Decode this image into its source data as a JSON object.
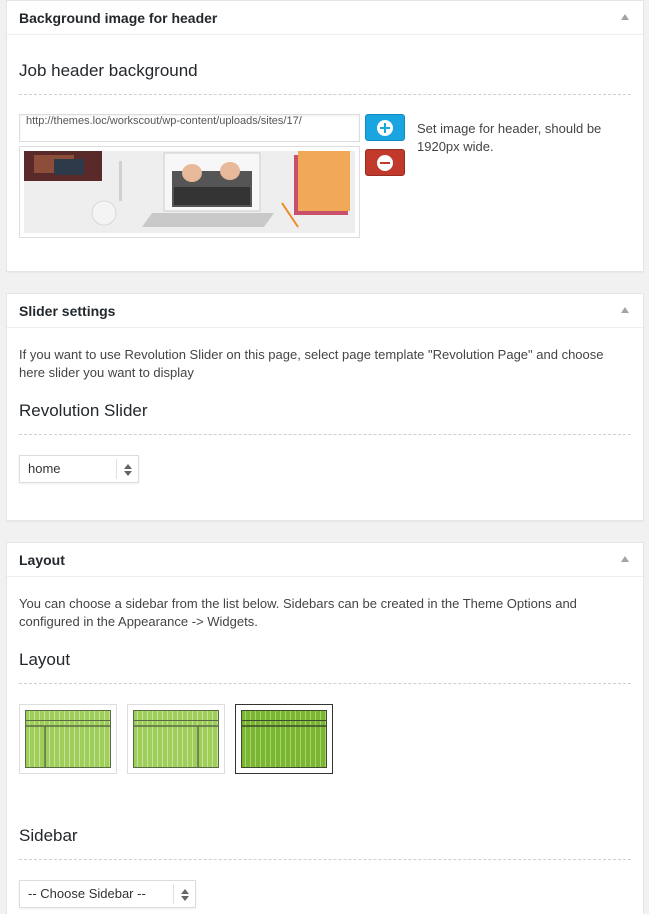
{
  "header_box": {
    "title": "Background image for header",
    "field_label": "Job header background",
    "url_value": "http://themes.loc/workscout/wp-content/uploads/sites/17/",
    "note": "Set image for header, should be 1920px wide."
  },
  "slider_box": {
    "title": "Slider settings",
    "description": "If you want to use Revolution Slider on this page, select page template \"Revolution Page\" and choose here slider you want to display",
    "field_label": "Revolution Slider",
    "select_value": "home"
  },
  "layout_box": {
    "title": "Layout",
    "description": "You can choose a sidebar from the list below. Sidebars can be created in the Theme Options and configured in the Appearance -> Widgets.",
    "field_label": "Layout",
    "options": [
      "left-sidebar",
      "right-sidebar",
      "full-width"
    ],
    "selected_option": "full-width",
    "sidebar_label": "Sidebar",
    "sidebar_select_value": "-- Choose Sidebar --"
  },
  "colors": {
    "add_button": "#1aa4e0",
    "remove_button": "#c0392b",
    "layout_green": "#8dc63f",
    "layout_green_selected": "#7ab534"
  },
  "icons": {
    "add": "plus-circle-icon",
    "remove": "minus-circle-icon",
    "collapse": "triangle-up-icon"
  }
}
